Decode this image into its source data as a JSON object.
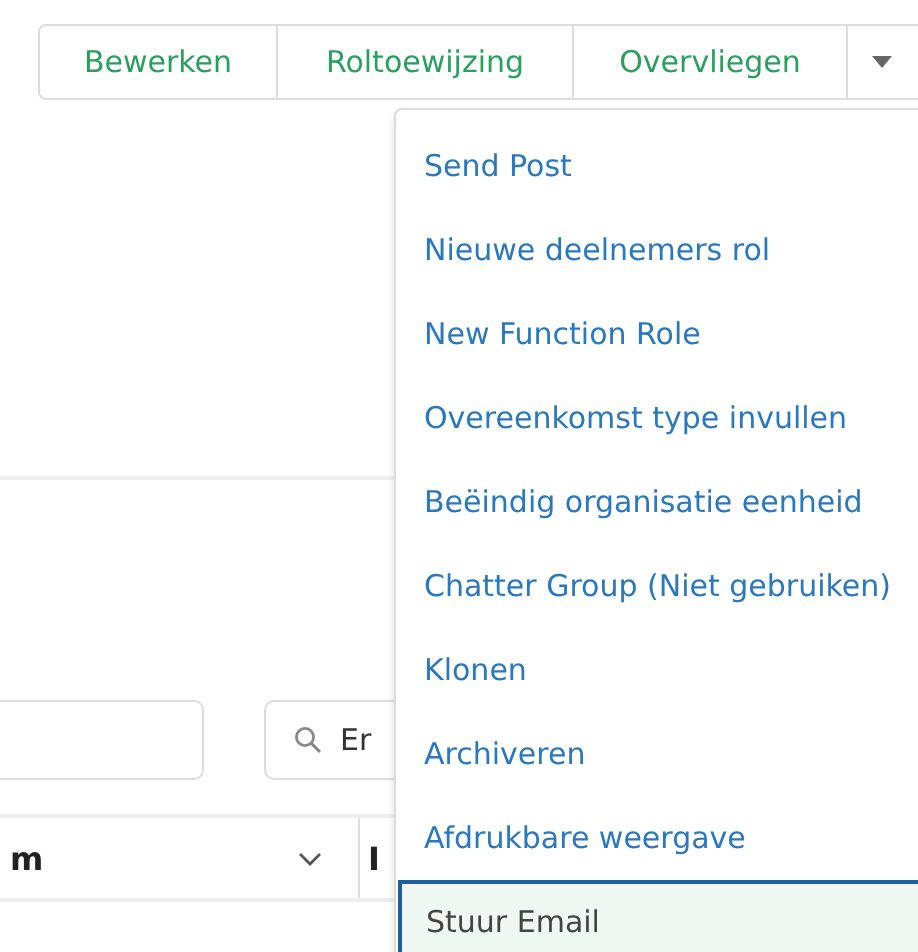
{
  "action_buttons": [
    {
      "label": "Bewerken"
    },
    {
      "label": "Roltoewijzing"
    },
    {
      "label": "Overvliegen"
    }
  ],
  "search_field": {
    "placeholder": "Er"
  },
  "table": {
    "columns": [
      {
        "label": "m",
        "sortable": true
      },
      {
        "label": "I",
        "sortable": false
      }
    ]
  },
  "menu": {
    "items": [
      {
        "label": "Send Post",
        "selected": false
      },
      {
        "label": "Nieuwe deelnemers rol",
        "selected": false
      },
      {
        "label": "New Function Role",
        "selected": false
      },
      {
        "label": "Overeenkomst type invullen",
        "selected": false
      },
      {
        "label": "Beëindig organisatie eenheid",
        "selected": false
      },
      {
        "label": "Chatter Group (Niet gebruiken)",
        "selected": false
      },
      {
        "label": "Klonen",
        "selected": false
      },
      {
        "label": "Archiveren",
        "selected": false
      },
      {
        "label": "Afdrukbare weergave",
        "selected": false
      },
      {
        "label": "Stuur Email",
        "selected": true
      }
    ]
  }
}
